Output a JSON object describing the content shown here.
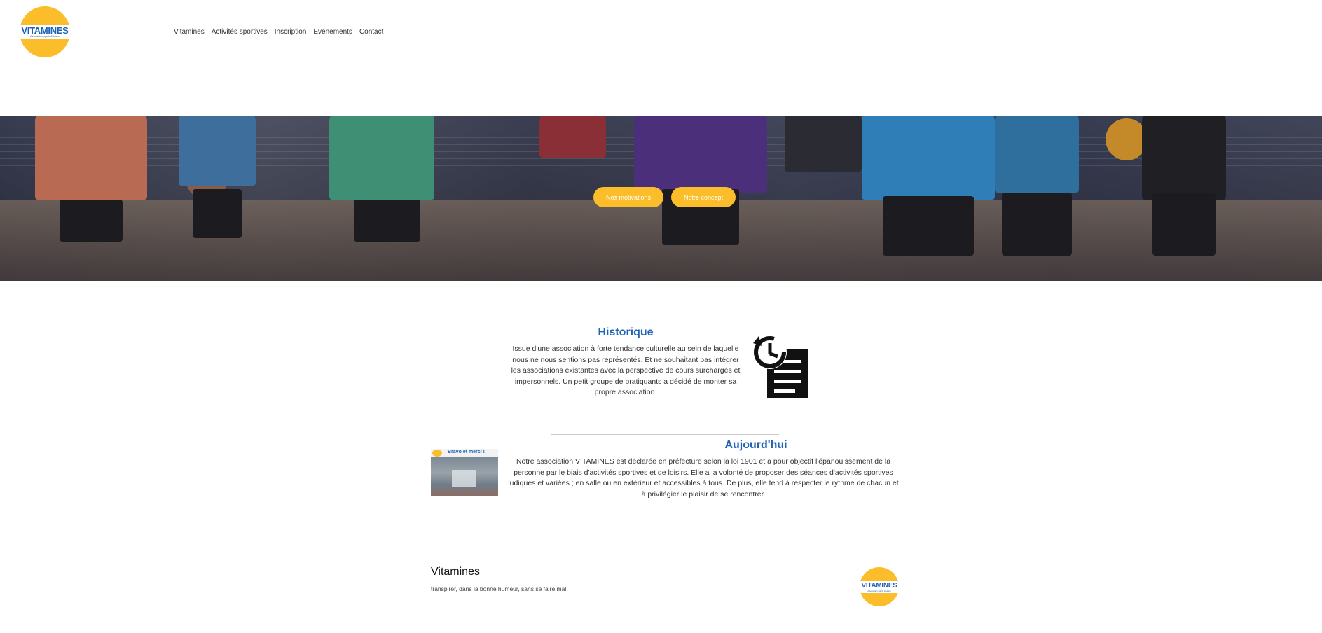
{
  "brand": {
    "logo_title": "VITAMINES",
    "logo_subtitle": "Association sports & loisirs",
    "accent_color": "#fbbd29",
    "title_color": "#1e63b5"
  },
  "nav": {
    "items": [
      {
        "label": "Vitamines"
      },
      {
        "label": "Activités sportives"
      },
      {
        "label": "Inscription"
      },
      {
        "label": "Evénements"
      },
      {
        "label": "Contact"
      }
    ]
  },
  "hero": {
    "buttons": [
      {
        "label": "Nos motivations"
      },
      {
        "label": "Notre concept"
      }
    ]
  },
  "historique": {
    "title": "Historique",
    "text": "Issue d'une association à forte tendance culturelle au sein de laquelle nous ne nous sentions pas représentés. Et ne souhaitant pas intégrer les associations existantes avec la perspective de cours surchargés et impersonnels. Un petit groupe de pratiquants a décidé de monter sa propre association.",
    "icon": "history-document-icon"
  },
  "aujourdhui": {
    "title": "Aujourd'hui",
    "text": "Notre association VITAMINES est déclarée en préfecture selon la loi 1901 et a pour objectif l'épanouissement de la personne par le biais d'activités sportives et de loisirs. Elle a la volonté de proposer des séances d'activités sportives ludiques et variées ; en salle ou en extérieur et accessibles à tous. De plus, elle tend à respecter le rythme de chacun et à privilégier le plaisir de se rencontrer.",
    "image_caption": "Bravo et merci !"
  },
  "footer": {
    "title": "Vitamines",
    "tagline": "transpirer, dans la bonne humeur, sans se faire mal"
  }
}
